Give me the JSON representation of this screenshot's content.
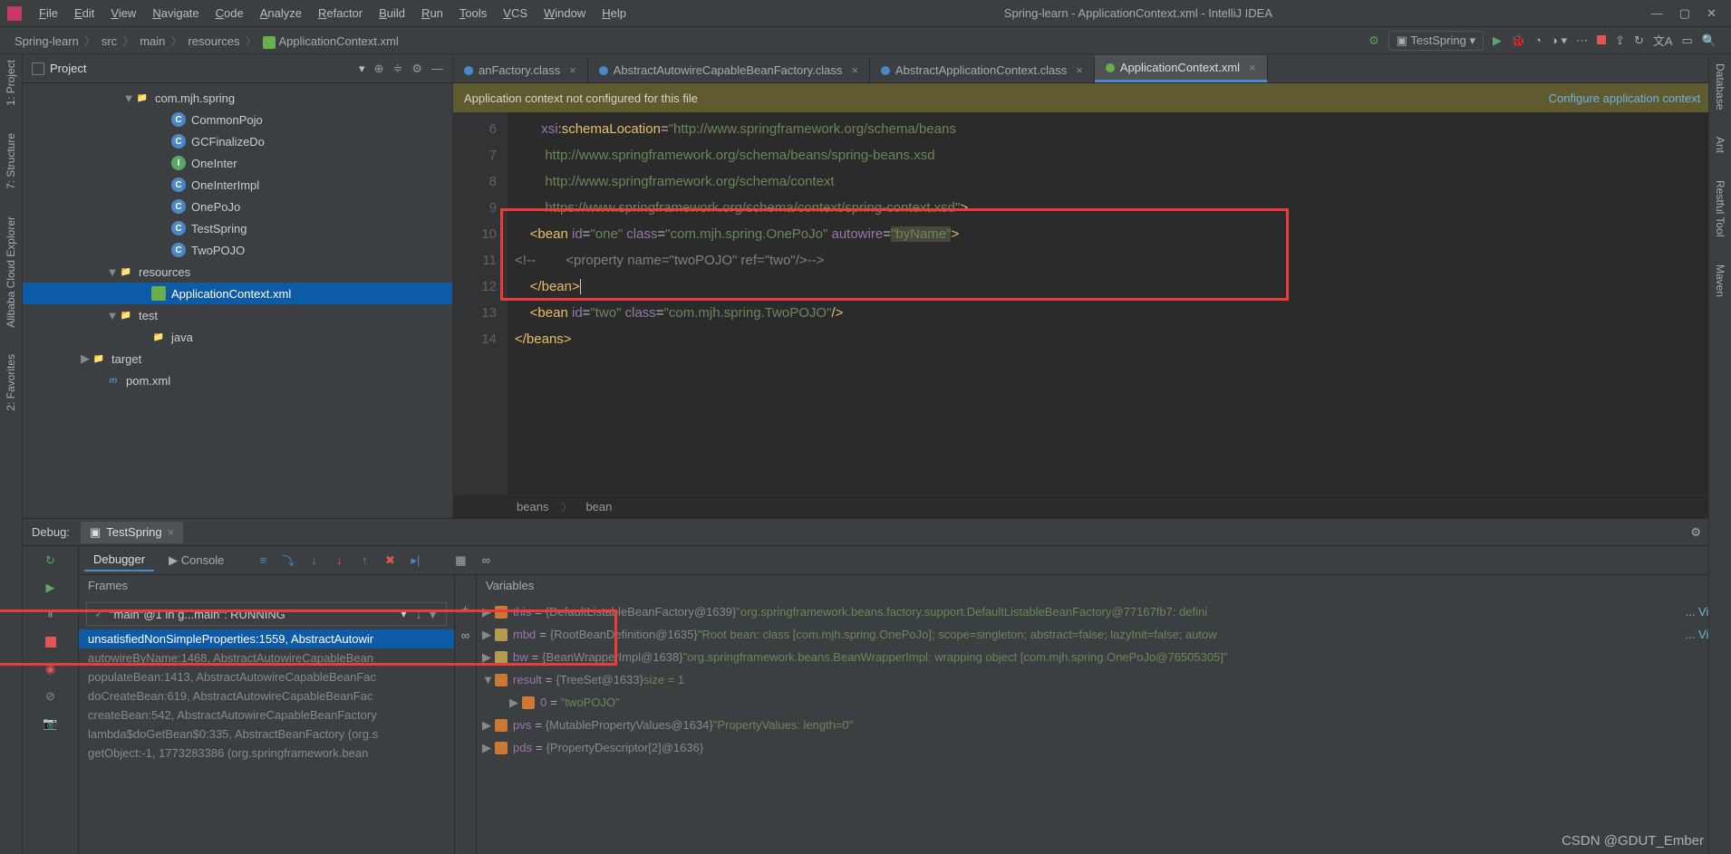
{
  "title": "Spring-learn - ApplicationContext.xml - IntelliJ IDEA",
  "menus": [
    "File",
    "Edit",
    "View",
    "Navigate",
    "Code",
    "Analyze",
    "Refactor",
    "Build",
    "Run",
    "Tools",
    "VCS",
    "Window",
    "Help"
  ],
  "crumbs": [
    "Spring-learn",
    "src",
    "main",
    "resources",
    "ApplicationContext.xml"
  ],
  "runcfg": "TestSpring",
  "leftTabs": [
    "1: Project",
    "7: Structure",
    "Alibaba Cloud Explorer",
    "2: Favorites"
  ],
  "rightTabs": [
    "Database",
    "Ant",
    "Restful Tool",
    "Maven"
  ],
  "project": {
    "title": "Project",
    "nodes": [
      {
        "indent": 110,
        "arrow": "▼",
        "icon": "folder",
        "label": "com.mjh.spring"
      },
      {
        "indent": 150,
        "arrow": "",
        "icon": "C",
        "label": "CommonPojo"
      },
      {
        "indent": 150,
        "arrow": "",
        "icon": "C",
        "label": "GCFinalizeDo"
      },
      {
        "indent": 150,
        "arrow": "",
        "icon": "I",
        "label": "OneInter"
      },
      {
        "indent": 150,
        "arrow": "",
        "icon": "C",
        "label": "OneInterImpl"
      },
      {
        "indent": 150,
        "arrow": "",
        "icon": "C",
        "label": "OnePoJo"
      },
      {
        "indent": 150,
        "arrow": "",
        "icon": "C",
        "label": "TestSpring"
      },
      {
        "indent": 150,
        "arrow": "",
        "icon": "C",
        "label": "TwoPOJO"
      },
      {
        "indent": 92,
        "arrow": "▼",
        "icon": "folder",
        "label": "resources"
      },
      {
        "indent": 128,
        "arrow": "",
        "icon": "xml",
        "label": "ApplicationContext.xml",
        "sel": true
      },
      {
        "indent": 92,
        "arrow": "▼",
        "icon": "folder",
        "label": "test"
      },
      {
        "indent": 128,
        "arrow": "",
        "icon": "folder",
        "label": "java"
      },
      {
        "indent": 62,
        "arrow": "▶",
        "icon": "folder",
        "label": "target"
      },
      {
        "indent": 78,
        "arrow": "",
        "icon": "m",
        "label": "pom.xml"
      }
    ]
  },
  "editorTabs": [
    {
      "label": "anFactory.class",
      "icon": "b"
    },
    {
      "label": "AbstractAutowireCapableBeanFactory.class",
      "icon": "b"
    },
    {
      "label": "AbstractApplicationContext.class",
      "icon": "b"
    },
    {
      "label": "ApplicationContext.xml",
      "icon": "g",
      "active": true
    }
  ],
  "banner": {
    "msg": "Application context not configured for this file",
    "link": "Configure application context"
  },
  "gutter": [
    "6",
    "7",
    "8",
    "9",
    "10",
    "11",
    "12",
    "13",
    "14"
  ],
  "breadcrumb2": [
    "beans",
    "bean"
  ],
  "debug": {
    "label": "Debug:",
    "tab": "TestSpring",
    "seg": [
      "Debugger",
      "Console"
    ],
    "framesTitle": "Frames",
    "varsTitle": "Variables",
    "thread": "\"main\"@1 in g...main\": RUNNING",
    "frames": [
      {
        "t": "unsatisfiedNonSimpleProperties:1559, AbstractAutowir",
        "sel": true
      },
      {
        "t": "autowireByName:1468, AbstractAutowireCapableBean"
      },
      {
        "t": "populateBean:1413, AbstractAutowireCapableBeanFac"
      },
      {
        "t": "doCreateBean:619, AbstractAutowireCapableBeanFac"
      },
      {
        "t": "createBean:542, AbstractAutowireCapableBeanFactory"
      },
      {
        "t": "lambda$doGetBean$0:335, AbstractBeanFactory (org.s"
      },
      {
        "t": "getObject:-1, 1773283386 (org.springframework.bean"
      }
    ],
    "vars": [
      {
        "arr": "▶",
        "ic": "e",
        "nm": "this",
        "val": "{DefaultListableBeanFactory@1639}",
        "str": " \"org.springframework.beans.factory.support.DefaultListableBeanFactory@77167fb7: defini",
        "view": "View"
      },
      {
        "arr": "▶",
        "ic": "p",
        "nm": "mbd",
        "val": "{RootBeanDefinition@1635}",
        "str": " \"Root bean: class [com.mjh.spring.OnePoJo]; scope=singleton; abstract=false; lazyInit=false; autow",
        "view": "View"
      },
      {
        "arr": "▶",
        "ic": "p",
        "nm": "bw",
        "val": "{BeanWrapperImpl@1638}",
        "str": " \"org.springframework.beans.BeanWrapperImpl: wrapping object [com.mjh.spring.OnePoJo@76505305]\""
      },
      {
        "arr": "▼",
        "ic": "e",
        "nm": "result",
        "val": "{TreeSet@1633}",
        "str": "  size = 1"
      },
      {
        "arr": "▶",
        "ic": "e",
        "nm": "0",
        "val": "",
        "str": "\"twoPOJO\"",
        "indent": 30
      },
      {
        "arr": "▶",
        "ic": "e",
        "nm": "pvs",
        "val": "{MutablePropertyValues@1634}",
        "str": " \"PropertyValues: length=0\""
      },
      {
        "arr": "▶",
        "ic": "e",
        "nm": "pds",
        "val": "{PropertyDescriptor[2]@1636}"
      }
    ]
  },
  "watermark": "CSDN @GDUT_Ember"
}
